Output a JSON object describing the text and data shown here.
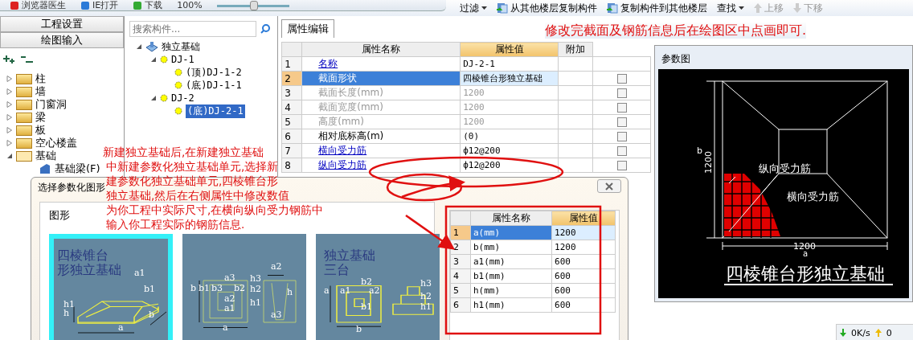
{
  "browser_bar": {
    "items": [
      "浏览器医生",
      "IE打开",
      "下载"
    ],
    "zoom": "100%",
    "zoom_slider": {
      "level": 0.5
    }
  },
  "toolbar": {
    "items": [
      {
        "label": "过滤",
        "kind": "dropdown",
        "disabled": false
      },
      {
        "label": "从其他楼层复制构件",
        "kind": "copy",
        "disabled": false
      },
      {
        "label": "复制构件到其他楼层",
        "kind": "copy",
        "disabled": false
      },
      {
        "label": "查找",
        "kind": "dropdown",
        "disabled": false
      },
      {
        "label": "上移",
        "kind": "up",
        "disabled": true
      },
      {
        "label": "下移",
        "kind": "down",
        "disabled": true
      }
    ]
  },
  "nav": {
    "buttons": [
      "工程设置",
      "绘图输入"
    ],
    "tree": [
      {
        "label": "柱",
        "expanded": false
      },
      {
        "label": "墙",
        "expanded": false
      },
      {
        "label": "门窗洞",
        "expanded": false
      },
      {
        "label": "梁",
        "expanded": false
      },
      {
        "label": "板",
        "expanded": false
      },
      {
        "label": "空心楼盖",
        "expanded": false
      },
      {
        "label": "基础",
        "expanded": true,
        "children": [
          {
            "label": "基础梁(F)"
          }
        ]
      }
    ]
  },
  "component_tree": {
    "search": {
      "placeholder": "搜索构件..."
    },
    "root": {
      "label": "独立基础",
      "expanded": true,
      "children": [
        {
          "label": "DJ-1",
          "expanded": true,
          "children": [
            {
              "label": "(顶)DJ-1-2",
              "selected": false
            },
            {
              "label": "(底)DJ-1-1",
              "selected": false
            }
          ]
        },
        {
          "label": "DJ-2",
          "expanded": true,
          "children": [
            {
              "label": "(底)DJ-2-1",
              "selected": true
            }
          ]
        }
      ]
    }
  },
  "properties": {
    "tab": "属性编辑",
    "columns": [
      "属性名称",
      "属性值",
      "附加"
    ],
    "rows": [
      {
        "index": "1",
        "name": "名称",
        "value": "DJ-2-1",
        "kind": "public",
        "disabled": false,
        "selected": false
      },
      {
        "index": "2",
        "name": "截面形状",
        "value": "四棱锥台形独立基础",
        "kind": "public",
        "disabled": false,
        "selected": true,
        "checked": false
      },
      {
        "index": "3",
        "name": "截面长度(mm)",
        "value": "1200",
        "kind": "private",
        "disabled": true,
        "selected": false,
        "checked": false
      },
      {
        "index": "4",
        "name": "截面宽度(mm)",
        "value": "1200",
        "kind": "private",
        "disabled": true,
        "selected": false,
        "checked": false
      },
      {
        "index": "5",
        "name": "高度(mm)",
        "value": "1200",
        "kind": "private",
        "disabled": true,
        "selected": false,
        "checked": false
      },
      {
        "index": "6",
        "name": "相对底标高(m)",
        "value": "(0)",
        "kind": "private",
        "disabled": false,
        "selected": false,
        "checked": false
      },
      {
        "index": "7",
        "name": "横向受力筋",
        "value": "ф12@200",
        "kind": "public",
        "disabled": false,
        "selected": false,
        "checked": false
      },
      {
        "index": "8",
        "name": "纵向受力筋",
        "value": "ф12@200",
        "kind": "public",
        "disabled": false,
        "selected": false,
        "checked": false
      }
    ]
  },
  "param_view": {
    "title": "参数图",
    "labels": [
      "b",
      "1200",
      "纵向受力筋",
      "横向受力筋",
      "1200",
      "a"
    ],
    "caption": "四棱锥台形独立基础"
  },
  "dialog": {
    "title": "选择参数化图形",
    "group": "图形",
    "shapes": [
      {
        "kind": "frustum",
        "selected": true,
        "title_lines": [
          "四棱锥台",
          "形独立基础"
        ],
        "labels": [
          "a1",
          "b1",
          "h1",
          "h",
          "b",
          "a"
        ]
      },
      {
        "kind": "cup",
        "selected": false,
        "labels": [
          "a2",
          "a3",
          "h3",
          "b",
          "b1",
          "b3",
          "b2",
          "h2",
          "h",
          "a2",
          "h1",
          "a1",
          "a3",
          "a"
        ]
      },
      {
        "kind": "steps",
        "selected": false,
        "title_lines": [
          "独立基础",
          "三台"
        ],
        "labels": [
          "b2",
          "h3",
          "a",
          "a1",
          "a2",
          "h2",
          "b1",
          "h1",
          "b"
        ]
      }
    ],
    "columns": [
      "属性名称",
      "属性值"
    ],
    "rows": [
      {
        "index": "1",
        "name": "a(mm)",
        "value": "1200",
        "selected": true
      },
      {
        "index": "2",
        "name": "b(mm)",
        "value": "1200",
        "selected": false
      },
      {
        "index": "3",
        "name": "a1(mm)",
        "value": "600",
        "selected": false
      },
      {
        "index": "4",
        "name": "b1(mm)",
        "value": "600",
        "selected": false
      },
      {
        "index": "5",
        "name": "h(mm)",
        "value": "600",
        "selected": false
      },
      {
        "index": "6",
        "name": "h1(mm)",
        "value": "600",
        "selected": false
      }
    ]
  },
  "annotations": {
    "top": "修改完截面及钢筋信息后在绘图区中点画即可.",
    "main_lines": [
      "新建独立基础后,在新建独立基础",
      "中新建参数化独立基础单元,选择新",
      "建参数化独立基础单元,四棱锥台形",
      "独立基础,然后在右侧属性中修改数值",
      "为你工程中实际尺寸,在横向纵向受力钢筋中",
      "输入你工程实际的钢筋信息."
    ]
  },
  "status": {
    "download": "0K/s",
    "upload": "0"
  }
}
